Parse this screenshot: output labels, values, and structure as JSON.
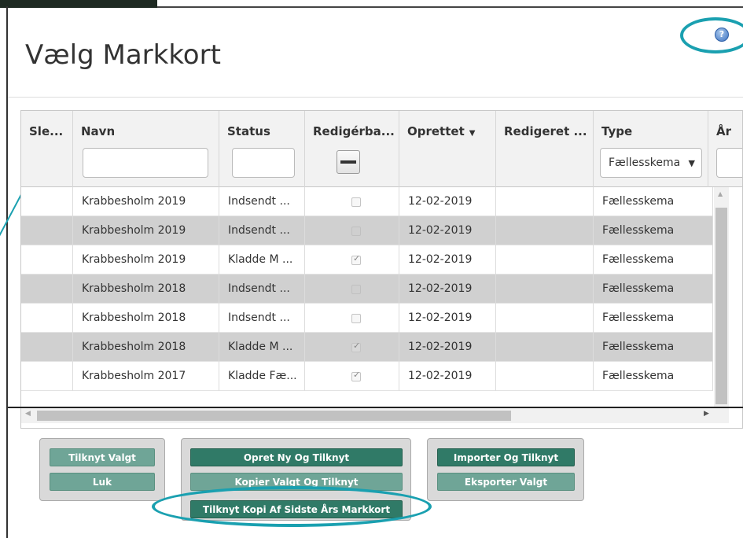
{
  "dialog": {
    "title": "Vælg Markkort"
  },
  "grid": {
    "columns": [
      {
        "label": "Sle...",
        "filter": "none"
      },
      {
        "label": "Navn",
        "filter": "text"
      },
      {
        "label": "Status",
        "filter": "text"
      },
      {
        "label": "Redigérba...",
        "filter": "tri-checkbox"
      },
      {
        "label": "Oprettet",
        "sort": "▼",
        "filter": "none"
      },
      {
        "label": "Redigeret ...",
        "filter": "none"
      },
      {
        "label": "Type",
        "filter": "select",
        "selected": "Fællesskema"
      },
      {
        "label": "År",
        "filter": "text"
      }
    ],
    "rows": [
      {
        "navn": "Krabbesholm 2019",
        "status": "Indsendt ...",
        "redigerbar": false,
        "oprettet": "12-02-2019",
        "redigeret": "",
        "type": "Fællesskema"
      },
      {
        "navn": "Krabbesholm 2019",
        "status": "Indsendt ...",
        "redigerbar": false,
        "oprettet": "12-02-2019",
        "redigeret": "",
        "type": "Fællesskema"
      },
      {
        "navn": "Krabbesholm 2019",
        "status": "Kladde M ...",
        "redigerbar": true,
        "oprettet": "12-02-2019",
        "redigeret": "",
        "type": "Fællesskema"
      },
      {
        "navn": "Krabbesholm 2018",
        "status": "Indsendt ...",
        "redigerbar": false,
        "oprettet": "12-02-2019",
        "redigeret": "",
        "type": "Fællesskema"
      },
      {
        "navn": "Krabbesholm 2018",
        "status": "Indsendt ...",
        "redigerbar": false,
        "oprettet": "12-02-2019",
        "redigeret": "",
        "type": "Fællesskema"
      },
      {
        "navn": "Krabbesholm 2018",
        "status": "Kladde M ...",
        "redigerbar": true,
        "oprettet": "12-02-2019",
        "redigeret": "",
        "type": "Fællesskema"
      },
      {
        "navn": "Krabbesholm 2017",
        "status": "Kladde Fæ...",
        "redigerbar": true,
        "oprettet": "12-02-2019",
        "redigeret": "",
        "type": "Fællesskema"
      }
    ]
  },
  "buttons": {
    "tilknyt_valgt": "Tilknyt Valgt",
    "luk": "Luk",
    "opret_ny": "Opret Ny Og Tilknyt",
    "kopier_valgt": "Kopier Valgt Og Tilknyt",
    "tilknyt_kopi": "Tilknyt Kopi Af Sidste Års Markkort",
    "importer": "Importer Og Tilknyt",
    "eksporter": "Eksporter Valgt"
  },
  "icons": {
    "help": "help-icon",
    "sort": "sort-desc-icon",
    "scroll_up": "scroll-up-icon",
    "scroll_left": "scroll-left-icon",
    "scroll_right": "scroll-right-icon"
  },
  "colors": {
    "button_dark": "#307a67",
    "button_light": "#6fa597",
    "highlight_ring": "#1aa0b0",
    "row_alt": "#d0d0d0"
  }
}
